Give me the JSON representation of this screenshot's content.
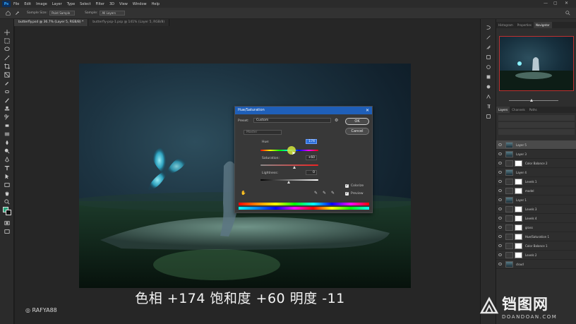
{
  "menubar": {
    "items": [
      "File",
      "Edit",
      "Image",
      "Layer",
      "Type",
      "Select",
      "Filter",
      "3D",
      "View",
      "Window",
      "Help"
    ]
  },
  "options": {
    "sample_size_label": "Sample Size:",
    "sample_size_value": "Point Sample",
    "sample_label": "Sample:",
    "sample_value": "All Layers"
  },
  "tabs": [
    {
      "label": "butterfly.psd @ 36.7% (Layer 5, RGB/8) *"
    },
    {
      "label": "butterfly-psp-1.psp @ 141% (Layer 5, RGB/8)"
    }
  ],
  "dialog": {
    "title": "Hue/Saturation",
    "preset_label": "Preset:",
    "preset_value": "Custom",
    "channel_value": "Master",
    "hue_label": "Hue:",
    "hue_value": "174",
    "saturation_label": "Saturation:",
    "saturation_value": "+60",
    "lightness_label": "Lightness:",
    "lightness_value": "0",
    "ok_label": "OK",
    "cancel_label": "Cancel",
    "colorize_label": "Colorize",
    "preview_label": "Preview"
  },
  "subtitle": "色相 +174 饱和度 +60 明度 -11",
  "instagram_handle": "RAFYA88",
  "right_panel": {
    "tabs_top": [
      "Histogram",
      "Properties",
      "Navigator"
    ],
    "tabs_layers": [
      "Layers",
      "Channels",
      "Paths"
    ],
    "layers": [
      {
        "name": "Layer 5",
        "active": true,
        "mask": false
      },
      {
        "name": "Layer 3",
        "active": false,
        "mask": false
      },
      {
        "name": "Color Balance 2",
        "active": false,
        "mask": true
      },
      {
        "name": "Layer 4",
        "active": false,
        "mask": false
      },
      {
        "name": "Levels 1",
        "active": false,
        "mask": true
      },
      {
        "name": "model",
        "active": false,
        "mask": true
      },
      {
        "name": "Layer 1",
        "active": false,
        "mask": false
      },
      {
        "name": "Levels 3",
        "active": false,
        "mask": true
      },
      {
        "name": "Levels 4",
        "active": false,
        "mask": true
      },
      {
        "name": "grass",
        "active": false,
        "mask": true
      },
      {
        "name": "Hue/Saturation 1",
        "active": false,
        "mask": true
      },
      {
        "name": "Color Balance 1",
        "active": false,
        "mask": true
      },
      {
        "name": "Levels 2",
        "active": false,
        "mask": true
      },
      {
        "name": "cloud",
        "active": false,
        "mask": false
      }
    ]
  },
  "site_watermark": {
    "main": "铛图网",
    "sub": "DOANDOAN.COM"
  },
  "colors": {
    "ui_dark": "#2b2b2b",
    "dialog_title": "#1f5fb8",
    "selection_blue": "#2e6fd9",
    "artwork_teal": "#2d4d5c"
  }
}
